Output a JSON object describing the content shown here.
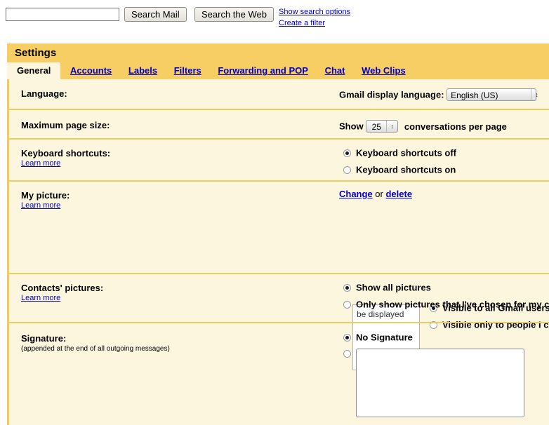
{
  "search": {
    "input_value": "",
    "input_placeholder": "",
    "search_mail_label": "Search Mail",
    "search_web_label": "Search the Web",
    "show_options_link": "Show search options",
    "create_filter_link": "Create a filter"
  },
  "settings": {
    "title": "Settings",
    "tabs": [
      {
        "label": "General",
        "active": true
      },
      {
        "label": "Accounts",
        "active": false
      },
      {
        "label": "Labels",
        "active": false
      },
      {
        "label": "Filters",
        "active": false
      },
      {
        "label": "Forwarding and POP",
        "active": false
      },
      {
        "label": "Chat",
        "active": false
      },
      {
        "label": "Web Clips",
        "active": false
      }
    ]
  },
  "rows": {
    "language": {
      "label": "Language:",
      "field_label": "Gmail display language:",
      "select_value": "English (US)",
      "select_arrow": "↕"
    },
    "page_size": {
      "label": "Maximum page size:",
      "show_label": "Show",
      "select_value": "25",
      "select_arrow": "↕",
      "suffix_label": "conversations per page"
    },
    "keyboard_shortcuts": {
      "label": "Keyboard shortcuts:",
      "learn_more": "Learn more",
      "option_off": "Keyboard shortcuts off",
      "option_on": "Keyboard shortcuts on",
      "selected": "off"
    },
    "my_picture": {
      "label": "My picture:",
      "learn_more": "Learn more",
      "change_link": "Change",
      "or_text": "or",
      "delete_link": "delete",
      "option_all": "Visible to all Gmail users",
      "option_limited": "Visible only to people I c",
      "selected": "all"
    },
    "contacts_pictures": {
      "label": "Contacts' pictures:",
      "learn_more": "Learn more",
      "option_all": "Show all pictures",
      "option_chosen": "Only show pictures that I've chosen for my c",
      "option_chosen_line2": "be displayed",
      "selected": "all"
    },
    "signature": {
      "label": "Signature:",
      "sub_label": "(appended at the end of all outgoing messages)",
      "option_none": "No Signature",
      "textarea_value": "",
      "selected": "none"
    }
  },
  "colors": {
    "header_gold": "#f6ce64",
    "panel_cream": "#fdf6df",
    "separator_gold": "#f0cb62",
    "link_blue": "#0000cc"
  }
}
